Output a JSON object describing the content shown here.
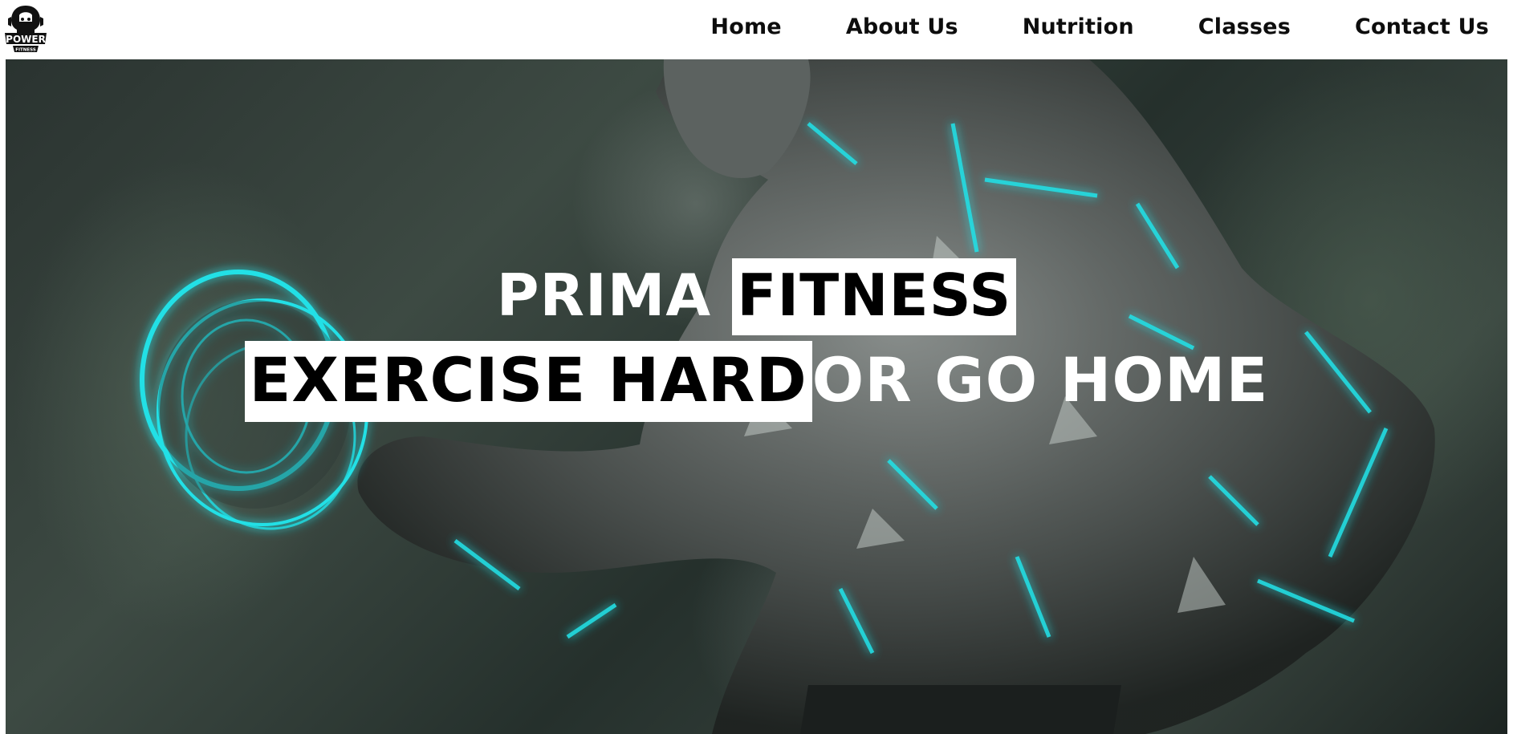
{
  "header": {
    "logo": {
      "icon": "power-fitness-logo",
      "text_top": "POWER",
      "text_bottom": "FITNESS"
    },
    "nav": {
      "items": [
        {
          "label": "Home"
        },
        {
          "label": "About Us"
        },
        {
          "label": "Nutrition"
        },
        {
          "label": "Classes"
        },
        {
          "label": "Contact Us"
        }
      ]
    }
  },
  "hero": {
    "image": "bodybuilder-with-dumbbell-illustration",
    "title_line1": {
      "part_white_text": "PRIMA ",
      "part_highlight": "FITNESS"
    },
    "title_line2": {
      "part_highlight": "EXERCISE HARD",
      "part_white_text": "OR GO HOME"
    }
  },
  "colors": {
    "nav_text": "#0d0d0d",
    "accent_glow": "#22e0e6",
    "highlight_bg": "#ffffff",
    "highlight_text": "#000000"
  }
}
